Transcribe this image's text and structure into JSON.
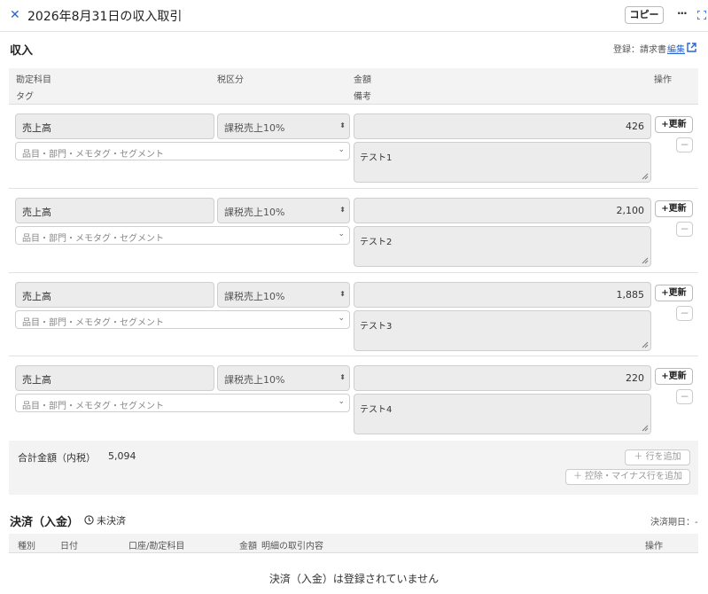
{
  "header": {
    "close_icon": "close-icon",
    "title": "2026年8月31日の収入取引",
    "copy_label": "コピー",
    "more_label": "···"
  },
  "income": {
    "section_title": "収入",
    "registration_label": "登録：請求書",
    "edit_link": "編集",
    "columns": {
      "account": "勘定科目",
      "tax": "税区分",
      "amount": "金額",
      "action": "操作",
      "tag": "タグ",
      "memo": "備考"
    },
    "tag_placeholder": "品目・部門・メモタグ・セグメント",
    "update_label": "+更新",
    "remove_label": "−",
    "rows": [
      {
        "account": "売上高",
        "tax": "課税売上10%",
        "amount": "426",
        "memo": "テスト1"
      },
      {
        "account": "売上高",
        "tax": "課税売上10%",
        "amount": "2,100",
        "memo": "テスト2"
      },
      {
        "account": "売上高",
        "tax": "課税売上10%",
        "amount": "1,885",
        "memo": "テスト3"
      },
      {
        "account": "売上高",
        "tax": "課税売上10%",
        "amount": "220",
        "memo": "テスト4"
      }
    ],
    "total_label": "合計金額（内税）",
    "total_value": "5,094",
    "add_row_label": "＋ 行を追加",
    "add_deduct_label": "＋ 控除・マイナス行を追加"
  },
  "payment": {
    "section_title": "決済（入金）",
    "status": "未決済",
    "due_label": "決済期日：-",
    "columns": {
      "type": "種別",
      "date": "日付",
      "account": "口座/勘定科目",
      "amount": "金額",
      "detail": "明細の取引内容",
      "action": "操作"
    },
    "empty_message": "決済（入金）は登録されていません"
  },
  "colors": {
    "accent": "#2864d4",
    "field_bg": "#ececec",
    "header_bg": "#f3f3f3"
  }
}
